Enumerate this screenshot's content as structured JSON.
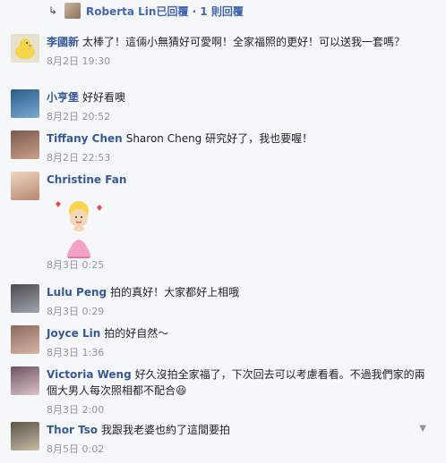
{
  "reply_header": {
    "icon": "reply-arrow-icon",
    "text": "Roberta Lin已回覆 · 1 則回覆"
  },
  "comments": [
    {
      "author": "李國新",
      "text": "太棒了！這倆小無猜好可愛啊！全家福照的更好！可以送我一套嗎？",
      "time": "8月2日 19:30"
    },
    {
      "author": "小亨堡",
      "text": "好好看噢",
      "time": "8月2日 20:52"
    },
    {
      "author": "Tiffany Chen",
      "text": "Sharon Cheng 研究好了，我也要喔！",
      "time": "8月2日 22:53"
    },
    {
      "author": "Christine Fan",
      "text": "",
      "time": "8月3日 0:25"
    },
    {
      "author": "Lulu Peng",
      "text": "拍的真好！大家都好上相哦",
      "time": "8月3日 0:29"
    },
    {
      "author": "Joyce Lin",
      "text": "拍的好自然～",
      "time": "8月3日 1:36"
    },
    {
      "author": "Victoria Weng",
      "text": "好久沒拍全家福了，下次回去可以考慮看看。不過我們家的兩個大男人每次照相都不配合😆",
      "time": "8月3日 2:00"
    },
    {
      "author": "Thor Tso",
      "text": "我跟我老婆也約了這間要拍",
      "time": "8月5日 0:02"
    }
  ],
  "icons": {
    "chevron": "chevron-down-icon"
  },
  "colors": {
    "link": "#365899",
    "meta": "#90949c",
    "background": "#f6f7f9"
  }
}
